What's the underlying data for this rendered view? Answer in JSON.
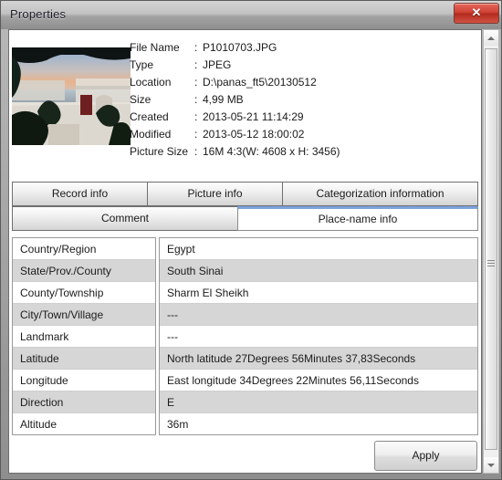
{
  "window": {
    "title": "Properties",
    "close_label": "✕"
  },
  "metadata": [
    {
      "label": "File Name",
      "colon": ":",
      "value": "P1010703.JPG"
    },
    {
      "label": "Type",
      "colon": ":",
      "value": "JPEG"
    },
    {
      "label": "Location",
      "colon": ":",
      "value": "D:\\panas_ft5\\20130512"
    },
    {
      "label": "Size",
      "colon": ":",
      "value": "4,99 MB"
    },
    {
      "label": "Created",
      "colon": ":",
      "value": "2013-05-21 11:14:29"
    },
    {
      "label": "Modified",
      "colon": ":",
      "value": "2013-05-12 18:00:02"
    },
    {
      "label": "Picture Size",
      "colon": ":",
      "value": "16M 4:3(W: 4608 x H: 3456)"
    }
  ],
  "tabs": {
    "row1": [
      {
        "label": "Record info",
        "active": false
      },
      {
        "label": "Picture info",
        "active": false
      },
      {
        "label": "Categorization information",
        "active": false
      }
    ],
    "row2": [
      {
        "label": "Comment",
        "active": false
      },
      {
        "label": "Place-name info",
        "active": true
      }
    ]
  },
  "fields": [
    {
      "label": "Country/Region",
      "value": "Egypt"
    },
    {
      "label": "State/Prov./County",
      "value": "South Sinai"
    },
    {
      "label": "County/Township",
      "value": "Sharm El Sheikh"
    },
    {
      "label": "City/Town/Village",
      "value": "---"
    },
    {
      "label": "Landmark",
      "value": "---"
    },
    {
      "label": "Latitude",
      "value": "North latitude 27Degrees 56Minutes 37,83Seconds"
    },
    {
      "label": "Longitude",
      "value": "East longitude 34Degrees 22Minutes 56,11Seconds"
    },
    {
      "label": "Direction",
      "value": "E"
    },
    {
      "label": "Altitude",
      "value": "36m"
    }
  ],
  "apply": {
    "label": "Apply"
  },
  "colors": {
    "active_tab_accent": "#7aa2dd",
    "close_button": "#d14335",
    "row_alt": "#d6d6d6"
  }
}
